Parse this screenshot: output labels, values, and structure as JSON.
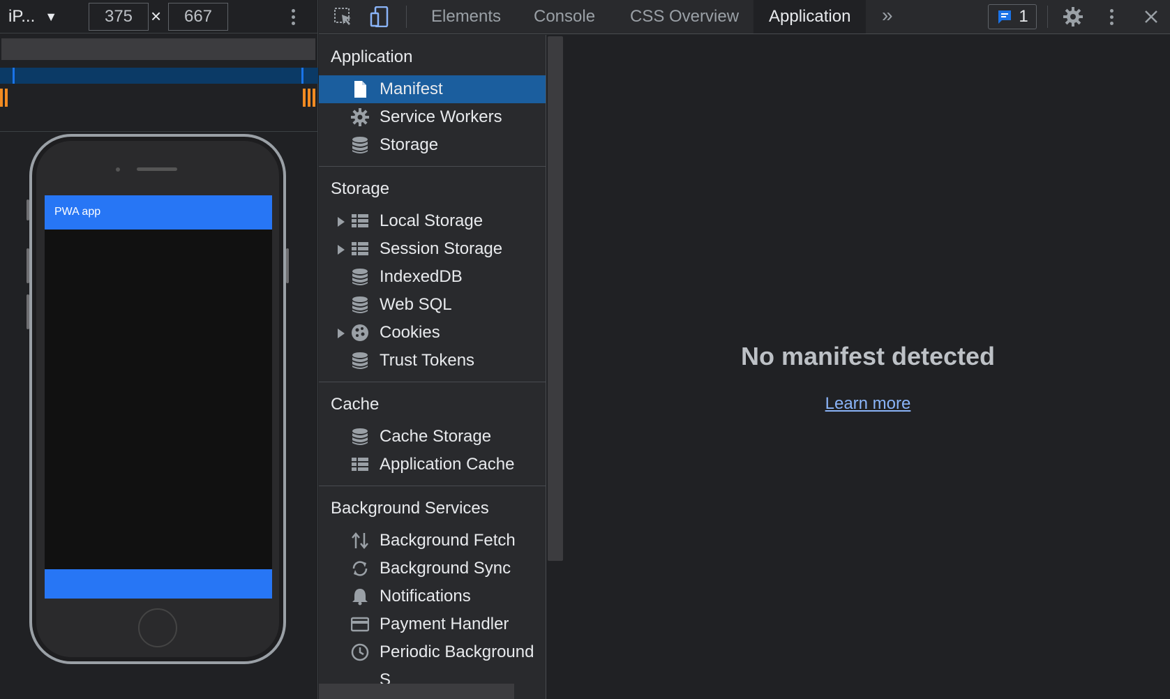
{
  "device_toolbar": {
    "device_name": "iP...",
    "width_value": "375",
    "height_value": "667",
    "times_symbol": "×"
  },
  "emulated_app": {
    "header_title": "PWA app",
    "brand_color": "#2776f5"
  },
  "devtools": {
    "tabs": [
      {
        "label": "Elements"
      },
      {
        "label": "Console"
      },
      {
        "label": "CSS Overview"
      },
      {
        "label": "Application"
      }
    ],
    "active_tab": "Application",
    "overflow_symbol": "»",
    "issues_count": "1",
    "accent_color": "#1a73e8"
  },
  "sidebar": {
    "sections": [
      {
        "title": "Application",
        "items": [
          {
            "label": "Manifest",
            "icon": "file-icon",
            "selected": true
          },
          {
            "label": "Service Workers",
            "icon": "gear-icon"
          },
          {
            "label": "Storage",
            "icon": "database-icon"
          }
        ]
      },
      {
        "title": "Storage",
        "items": [
          {
            "label": "Local Storage",
            "icon": "table-icon",
            "expandable": true
          },
          {
            "label": "Session Storage",
            "icon": "table-icon",
            "expandable": true
          },
          {
            "label": "IndexedDB",
            "icon": "database-icon"
          },
          {
            "label": "Web SQL",
            "icon": "database-icon"
          },
          {
            "label": "Cookies",
            "icon": "cookie-icon",
            "expandable": true
          },
          {
            "label": "Trust Tokens",
            "icon": "database-icon"
          }
        ]
      },
      {
        "title": "Cache",
        "items": [
          {
            "label": "Cache Storage",
            "icon": "database-icon"
          },
          {
            "label": "Application Cache",
            "icon": "table-icon"
          }
        ]
      },
      {
        "title": "Background Services",
        "items": [
          {
            "label": "Background Fetch",
            "icon": "arrows-updown-icon"
          },
          {
            "label": "Background Sync",
            "icon": "sync-icon"
          },
          {
            "label": "Notifications",
            "icon": "bell-icon"
          },
          {
            "label": "Payment Handler",
            "icon": "card-icon"
          },
          {
            "label": "Periodic Background S",
            "icon": "clock-icon"
          }
        ]
      }
    ]
  },
  "main": {
    "empty_title": "No manifest detected",
    "learn_more": "Learn more"
  }
}
